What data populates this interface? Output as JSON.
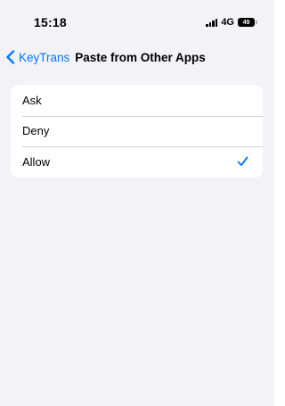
{
  "status_bar": {
    "time": "15:18",
    "network": "4G",
    "battery": "49"
  },
  "nav": {
    "back_label": "KeyTrans",
    "title": "Paste from Other Apps"
  },
  "options": [
    {
      "label": "Ask",
      "selected": false
    },
    {
      "label": "Deny",
      "selected": false
    },
    {
      "label": "Allow",
      "selected": true
    }
  ],
  "colors": {
    "accent": "#007aff",
    "background": "#f2f2f7",
    "card": "#ffffff"
  },
  "icons": {
    "back": "chevron-left-icon",
    "selected": "checkmark-icon"
  }
}
